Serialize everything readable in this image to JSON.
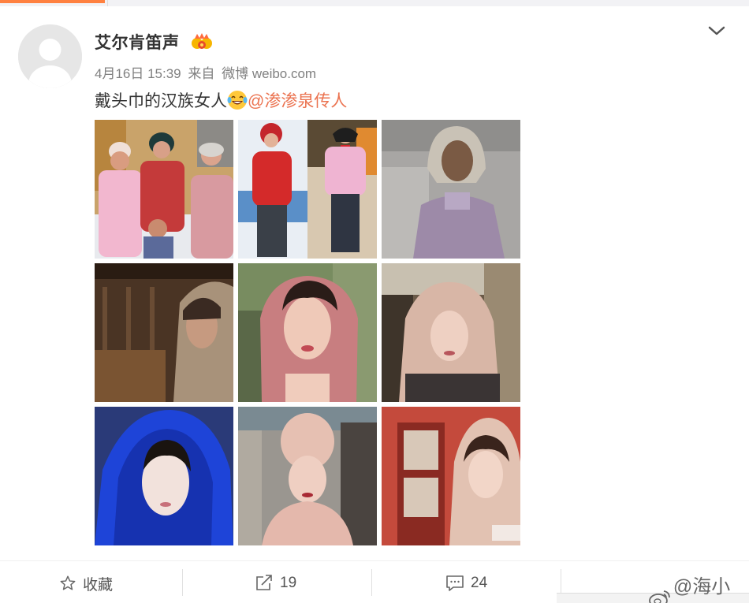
{
  "user": {
    "name": "艾尔肯笛声"
  },
  "meta": {
    "time": "4月16日 15:39",
    "from_prefix": "来自",
    "source": "微博 weibo.com"
  },
  "post": {
    "text": "戴头巾的汉族女人",
    "mention": "@渗渗泉传人"
  },
  "photos": [
    {
      "subject": "three women in headscarves with child, snowy village"
    },
    {
      "subject": "two girls in red and pink jackets, snow"
    },
    {
      "subject": "woman in grey headscarf, purple shirt"
    },
    {
      "subject": "woman in hood, dim wooden room"
    },
    {
      "subject": "woman in pink headscarf, outdoor"
    },
    {
      "subject": "woman in beige headscarf, wooden house"
    },
    {
      "subject": "woman in blue veil"
    },
    {
      "subject": "woman in pink turban"
    },
    {
      "subject": "woman in beige headscarf by red window"
    }
  ],
  "actions": {
    "favorite": "收藏",
    "repost_count": "19",
    "comment_count": "24"
  },
  "watermark": {
    "text": "@海小呆"
  },
  "colors": {
    "accent": "#ff8140",
    "mention": "#eb7350",
    "meta": "#808080"
  }
}
